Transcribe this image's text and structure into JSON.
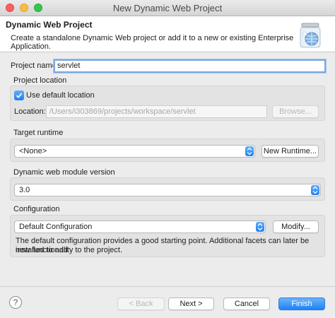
{
  "window": {
    "title": "New Dynamic Web Project"
  },
  "header": {
    "title": "Dynamic Web Project",
    "description": "Create a standalone Dynamic Web project or add it to a new or existing Enterprise Application."
  },
  "project_name": {
    "label": "Project name:",
    "value": "servlet"
  },
  "project_location": {
    "title": "Project location",
    "use_default_label": "Use default location",
    "use_default_checked": true,
    "location_label": "Location:",
    "location_value": "/Users/i303869/projects/workspace/servlet",
    "browse_label": "Browse..."
  },
  "target_runtime": {
    "title": "Target runtime",
    "selected": "<None>",
    "new_runtime_label": "New Runtime..."
  },
  "module_version": {
    "title": "Dynamic web module version",
    "selected": "3.0"
  },
  "configuration": {
    "title": "Configuration",
    "selected": "Default Configuration",
    "modify_label": "Modify...",
    "description_line1": "The default configuration provides a good starting point. Additional facets can later be installed to add",
    "description_line2": "new functionality to the project."
  },
  "footer": {
    "help_label": "?",
    "back_label": "< Back",
    "next_label": "Next >",
    "cancel_label": "Cancel",
    "finish_label": "Finish"
  }
}
